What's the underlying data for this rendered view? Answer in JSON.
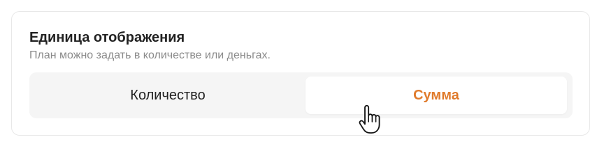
{
  "card": {
    "title": "Единица отображения",
    "subtitle": "План можно задать в количестве или деньгах."
  },
  "toggle": {
    "options": [
      {
        "label": "Количество",
        "selected": false
      },
      {
        "label": "Сумма",
        "selected": true
      }
    ],
    "accent_color": "#e07b2c"
  },
  "cursor": {
    "icon": "hand-pointer-icon"
  }
}
